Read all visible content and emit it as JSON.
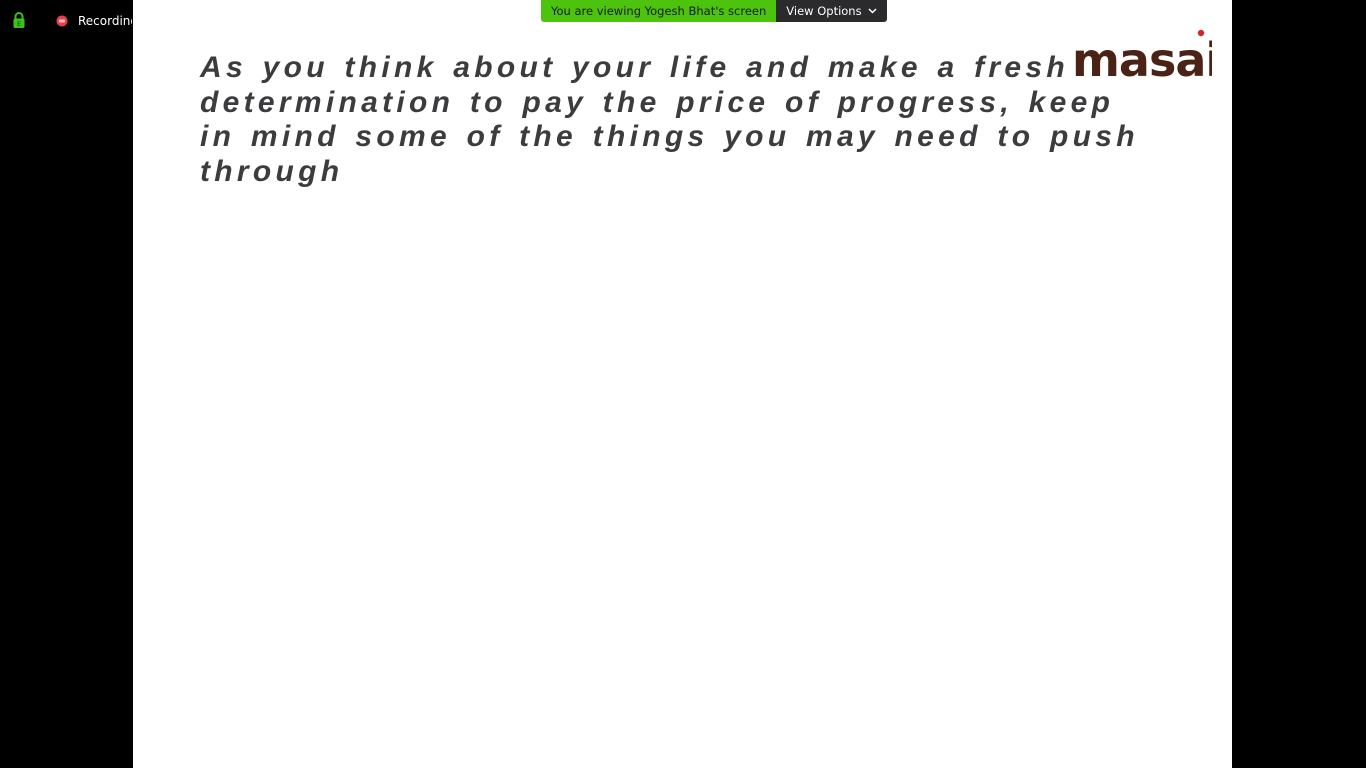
{
  "meeting": {
    "recording_label": "Recording",
    "share_banner": {
      "viewing_text": "You are viewing Yogesh Bhat's screen",
      "view_options_label": "View Options"
    }
  },
  "slide": {
    "quote": "As you think about your life and make a fresh determination to pay the price of progress, keep in mind some of the things you may need to push through",
    "logo_text": "masai"
  },
  "icons": {
    "lock": "lock-icon",
    "recording": "recording-dot-icon",
    "chevron": "chevron-down-icon"
  },
  "colors": {
    "background": "#000000",
    "slide_background": "#ffffff",
    "quote_text": "#3c3c3e",
    "banner_green": "#4cc40d",
    "banner_dark": "#2b2b2e",
    "logo_brown": "#4a2316",
    "logo_dot_red": "#d3262a",
    "recording_red": "#e0414b",
    "lock_green": "#3cc01a"
  }
}
